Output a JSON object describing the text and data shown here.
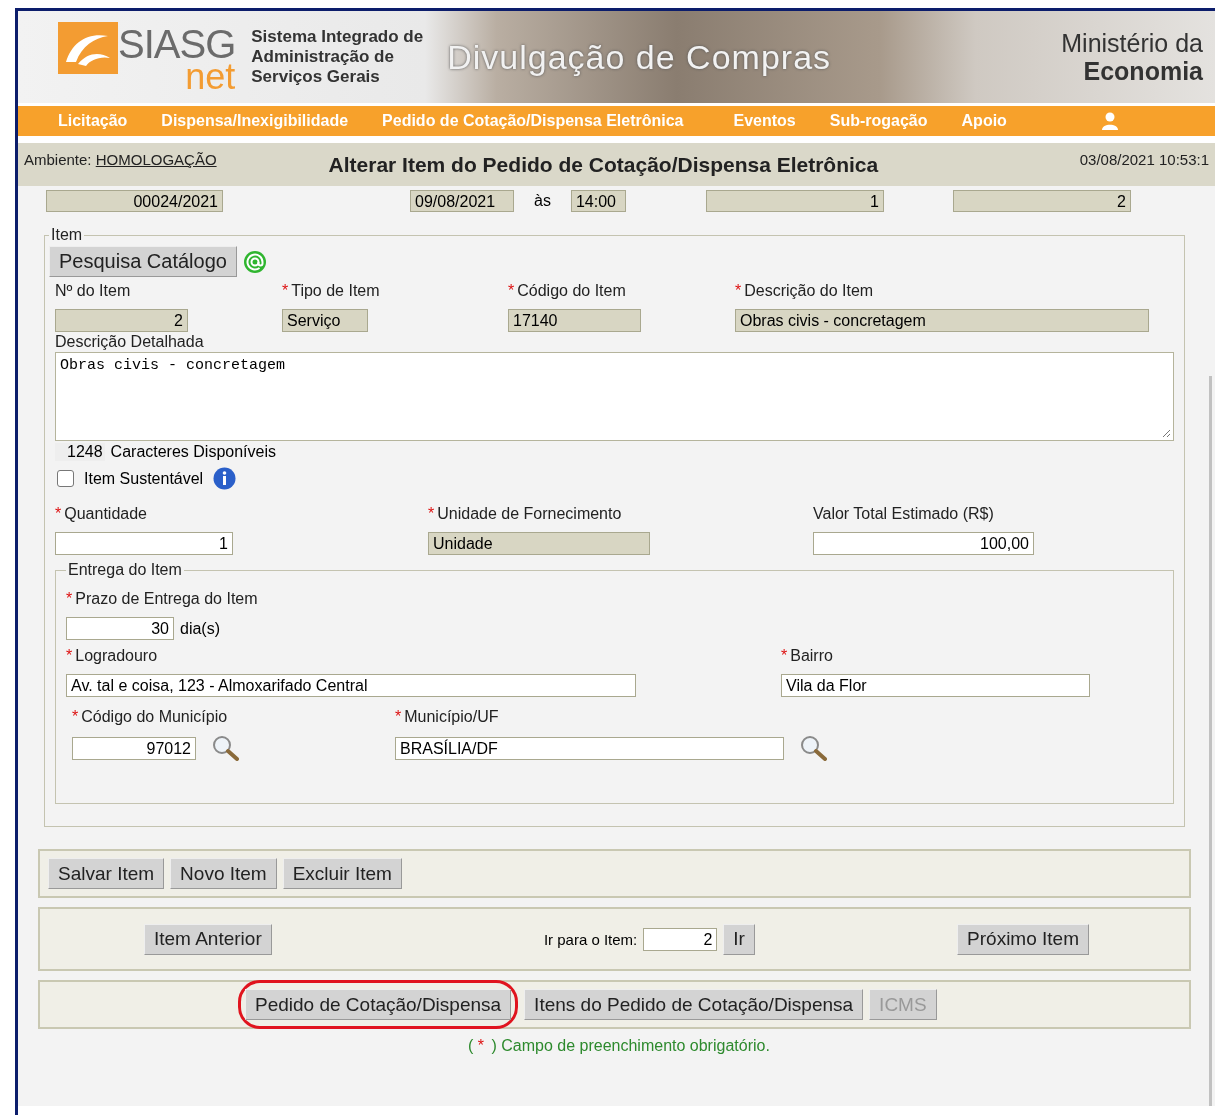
{
  "header": {
    "logo_text": "SIASG",
    "logo_sub": "net",
    "system_name": [
      "Sistema Integrado de",
      "Administração de",
      "Serviços Gerais"
    ],
    "banner_title": "Divulgação de Compras",
    "ministry": [
      "Ministério da",
      "Economia"
    ]
  },
  "nav": [
    "Licitação",
    "Dispensa/Inexigibilidade",
    "Pedido de Cotação/Dispensa Eletrônica",
    "Eventos",
    "Sub-rogação",
    "Apoio"
  ],
  "context_bar": {
    "label": "Ambiente:",
    "environment": "HOMOLOGAÇÃO",
    "title": "Alterar Item do Pedido de Cotação/Dispensa Eletrônica",
    "datetime": "03/08/2021 10:53:1"
  },
  "top_row": {
    "number": "00024/2021",
    "date": "09/08/2021",
    "at": "às",
    "time": "14:00",
    "field_5": "1",
    "field_6": "2"
  },
  "item": {
    "legend": "Item",
    "catalog_button": "Pesquisa Catálogo",
    "fields": [
      {
        "label": "Nº do Item",
        "value": "2",
        "readonly": true
      },
      {
        "label": "Tipo de Item",
        "mark": "*",
        "value": "Serviço",
        "readonly": true
      },
      {
        "label": "Código do Item",
        "mark": "*",
        "value": "17140",
        "readonly": true
      },
      {
        "label": "Descrição do Item",
        "mark": "*",
        "value": "Obras civis - concretagem",
        "readonly": true
      }
    ],
    "detail_label": "Descrição Detalhada",
    "detail_value": "Obras civis - concretagem",
    "chars_count": "1248",
    "chars_label": "Caracteres Disponíveis",
    "sustainable": {
      "label": "Item Sustentável",
      "checked": false
    },
    "quantity": {
      "label": "Quantidade",
      "mark": "*",
      "value": "1",
      "readonly": false
    },
    "unit": {
      "label": "Unidade de Fornecimento",
      "mark": "*",
      "value": "Unidade",
      "readonly": true
    },
    "total": {
      "label": "Valor Total Estimado (R$)",
      "value": "100,00",
      "readonly": false
    }
  },
  "delivery": {
    "legend": "Entrega do Item",
    "deadline": {
      "label": "Prazo de Entrega do Item",
      "mark": "*",
      "value": "30",
      "unit": "dia(s)"
    },
    "street": {
      "label": "Logradouro",
      "mark": "*",
      "value": "Av. tal e coisa, 123 - Almoxarifado Central"
    },
    "district": {
      "label": "Bairro",
      "mark": "*",
      "value": "Vila da Flor"
    },
    "city_code": {
      "label": "Código do Município",
      "mark": "*",
      "value": "97012"
    },
    "city": {
      "label": "Município/UF",
      "mark": "*",
      "value": "BRASÍLIA/DF"
    }
  },
  "actions": [
    {
      "label": "Salvar Item"
    },
    {
      "label": "Novo Item"
    },
    {
      "label": "Excluir Item"
    }
  ],
  "navigation": {
    "previous": "Item Anterior",
    "goto_label": "Ir para o Item:",
    "goto_value": "2",
    "go": "Ir",
    "next": "Próximo Item"
  },
  "links": [
    {
      "label": "Pedido de Cotação/Dispensa",
      "disabled": false,
      "highlighted": true
    },
    {
      "label": "Itens do Pedido de Cotação/Dispensa",
      "disabled": false,
      "highlighted": false
    },
    {
      "label": "ICMS",
      "disabled": true,
      "highlighted": false
    }
  ],
  "note": {
    "open": "(",
    "mark": "*",
    "text": ") Campo de preenchimento obrigatório."
  }
}
